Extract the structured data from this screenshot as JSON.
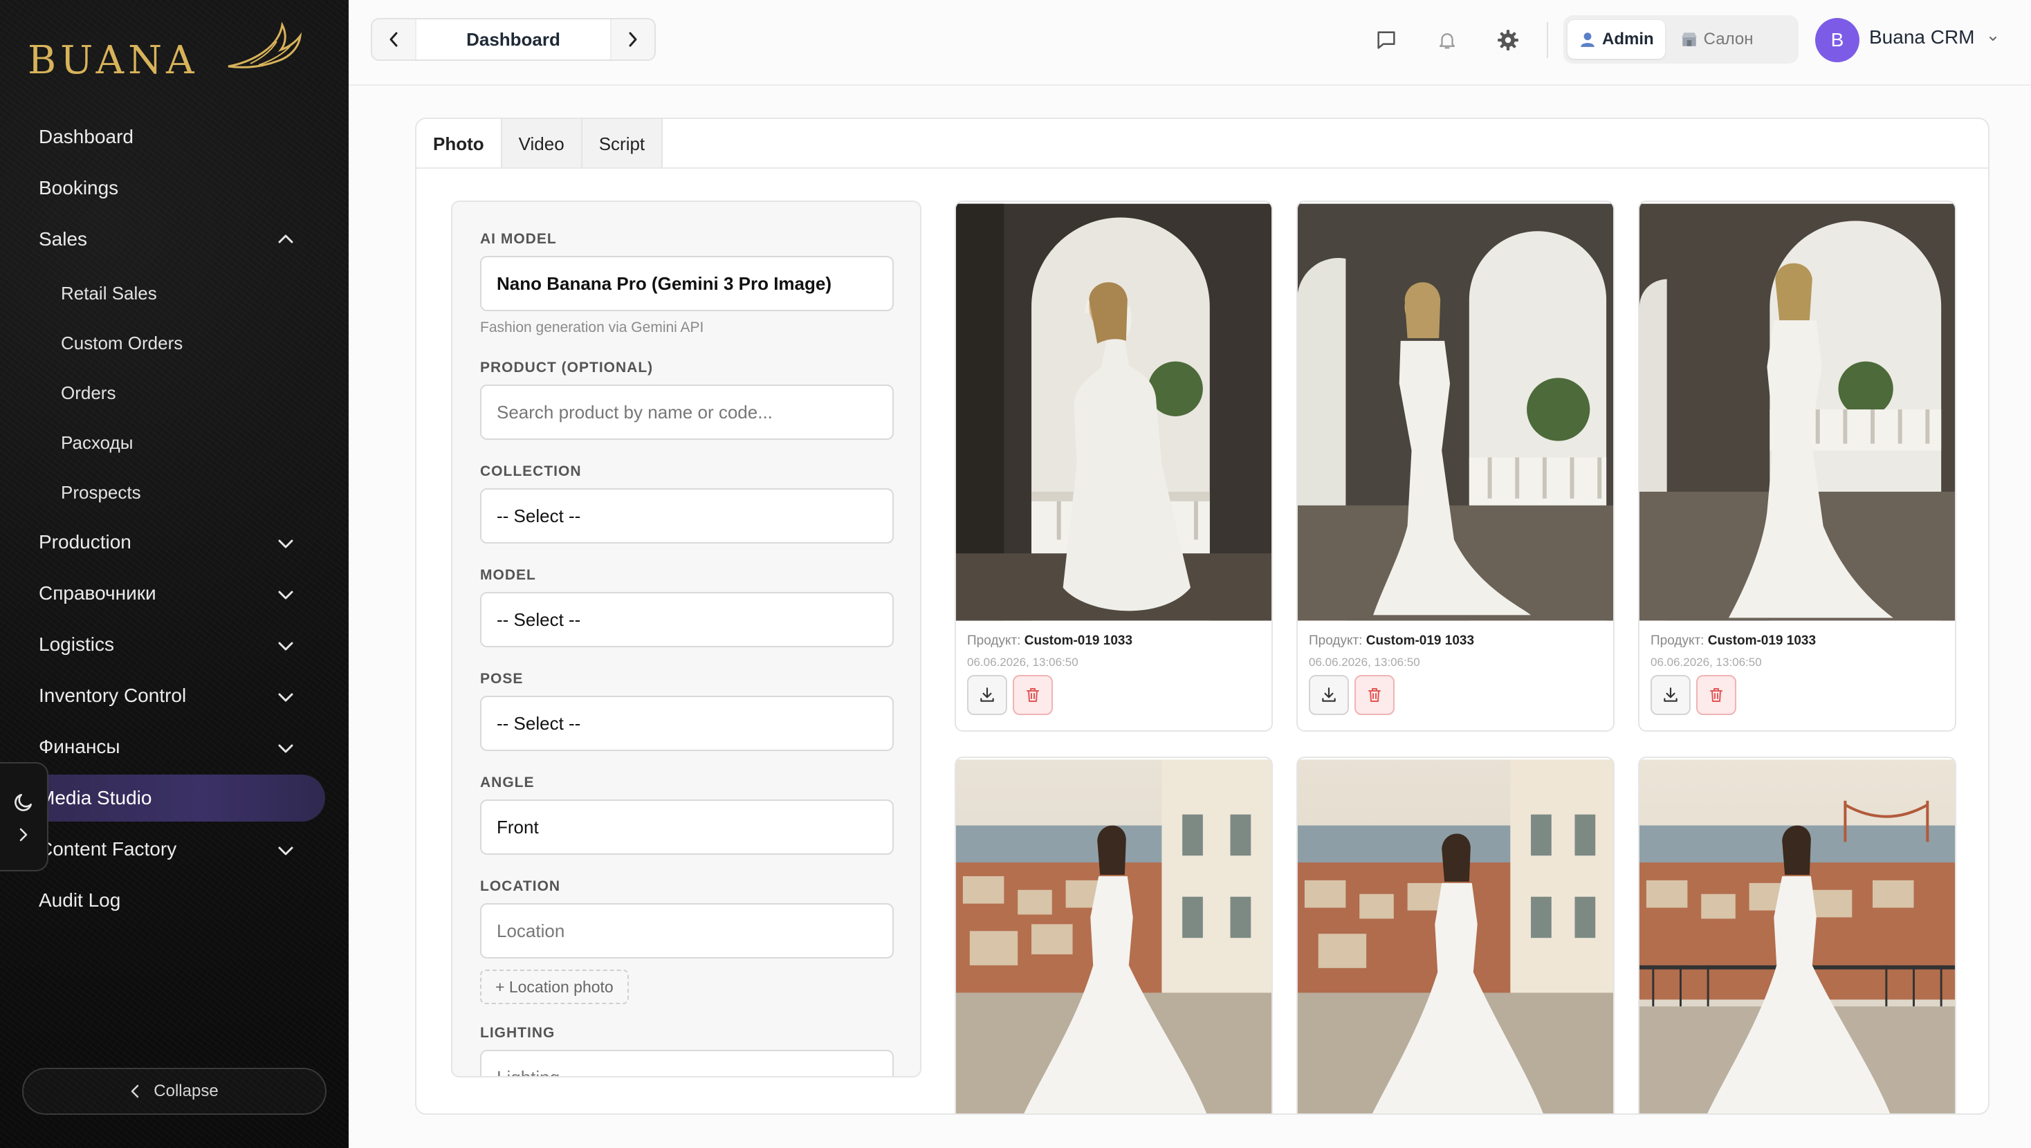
{
  "brand": {
    "logo_text": "BUANA"
  },
  "sidebar": {
    "items": [
      {
        "label": "Dashboard"
      },
      {
        "label": "Bookings"
      },
      {
        "label": "Sales"
      },
      {
        "label": "Retail Sales"
      },
      {
        "label": "Custom Orders"
      },
      {
        "label": "Orders"
      },
      {
        "label": "Расходы"
      },
      {
        "label": "Prospects"
      },
      {
        "label": "Production"
      },
      {
        "label": "Справочники"
      },
      {
        "label": "Logistics"
      },
      {
        "label": "Inventory Control"
      },
      {
        "label": "Финансы"
      },
      {
        "label": "Media Studio"
      },
      {
        "label": "Content Factory"
      },
      {
        "label": "Audit Log"
      }
    ],
    "collapse_label": "Collapse"
  },
  "header": {
    "breadcrumb_title": "Dashboard",
    "roles": [
      {
        "label": "Admin"
      },
      {
        "label": "Салон"
      }
    ],
    "avatar_initial": "B",
    "user_name": "Buana CRM"
  },
  "tabs": [
    {
      "label": "Photo"
    },
    {
      "label": "Video"
    },
    {
      "label": "Script"
    }
  ],
  "form": {
    "ai_model_label": "AI MODEL",
    "ai_model_value": "Nano Banana Pro (Gemini 3 Pro Image)",
    "ai_model_hint": "Fashion generation via Gemini API",
    "product_label": "PRODUCT (OPTIONAL)",
    "product_placeholder": "Search product by name or code...",
    "collection_label": "COLLECTION",
    "collection_value": "-- Select --",
    "model_label": "MODEL",
    "model_value": "-- Select --",
    "pose_label": "POSE",
    "pose_value": "-- Select --",
    "angle_label": "ANGLE",
    "angle_value": "Front",
    "location_label": "LOCATION",
    "location_placeholder": "Location",
    "location_photo_label": "+ Location photo",
    "lighting_label": "LIGHTING",
    "lighting_placeholder": "Lighting"
  },
  "gallery": {
    "product_prefix": "Продукт:",
    "items": [
      {
        "product": "Custom-019 1033",
        "date": "06.06.2026, 13:06:50"
      },
      {
        "product": "Custom-019 1033",
        "date": "06.06.2026, 13:06:50"
      },
      {
        "product": "Custom-019 1033",
        "date": "06.06.2026, 13:06:50"
      }
    ]
  },
  "colors": {
    "accent": "#7c5ce6",
    "sidebar_bg": "#111111",
    "active_nav": "#3b3166",
    "logo_gold": "#d8b35a",
    "danger": "#e05656"
  }
}
